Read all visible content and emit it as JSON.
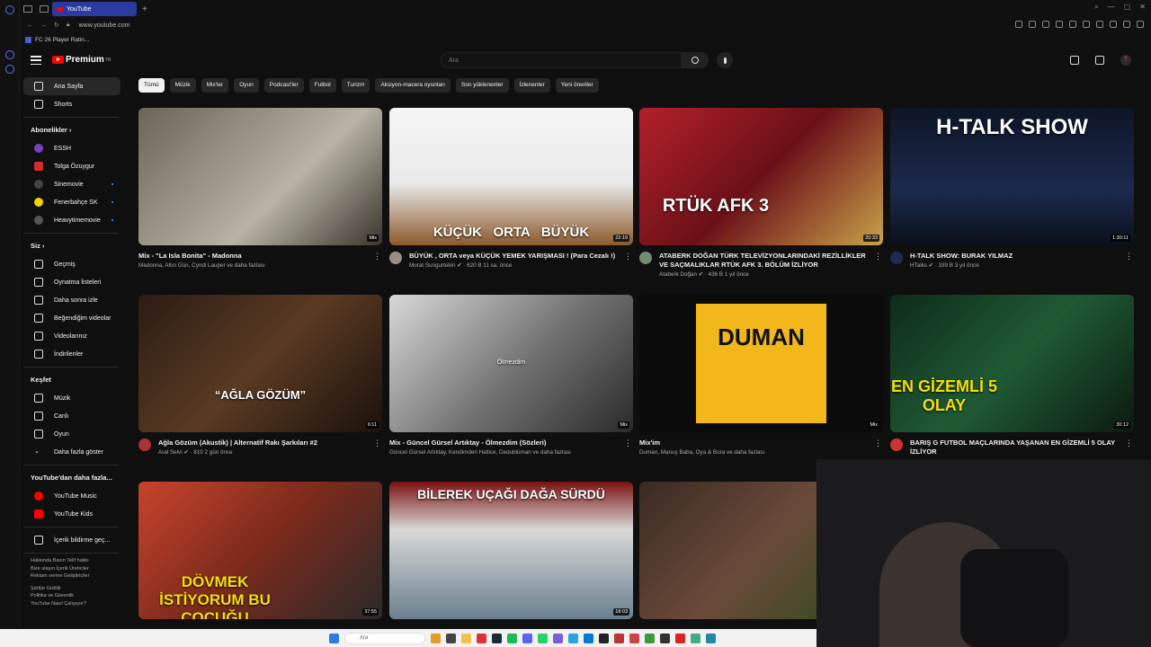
{
  "browser": {
    "tab_title": "YouTube",
    "url": "www.youtube.com",
    "bookmark": "FC 26 Player Ratin..."
  },
  "header": {
    "logo_text": "Premium",
    "logo_sup": "TR",
    "search_placeholder": "Ara",
    "avatar_letter": "T"
  },
  "sidebar": {
    "main": [
      {
        "label": "Ana Sayfa"
      },
      {
        "label": "Shorts"
      }
    ],
    "subs_title": "Abonelikler",
    "subs": [
      {
        "label": "ESSH",
        "color": "#7a3fc4"
      },
      {
        "label": "Tolga Özuygur",
        "color": "#d92b2b"
      },
      {
        "label": "Sinemovie",
        "color": "#444444"
      },
      {
        "label": "Fenerbahçe SK",
        "color": "#f5d000"
      },
      {
        "label": "Heavytimemovie",
        "color": "#555555"
      }
    ],
    "you_title": "Siz",
    "you": [
      {
        "label": "Geçmiş"
      },
      {
        "label": "Oynatma listeleri"
      },
      {
        "label": "Daha sonra izle"
      },
      {
        "label": "Beğendiğim videolar"
      },
      {
        "label": "Videolarınız"
      },
      {
        "label": "İndirilenler"
      }
    ],
    "explore_title": "Keşfet",
    "explore": [
      {
        "label": "Müzik"
      },
      {
        "label": "Canlı"
      },
      {
        "label": "Oyun"
      },
      {
        "label": "Daha fazla göster"
      }
    ],
    "more_title": "YouTube'dan daha fazla...",
    "more": [
      {
        "label": "YouTube Music"
      },
      {
        "label": "YouTube Kids"
      }
    ],
    "report": "İçerik bildirme geç...",
    "footer": [
      "Hakkında  Basın  Telif hakkı",
      "Bize ulaşın  İçerik Üreticiler",
      "Reklam verme  Geliştiriciler",
      "",
      "Şartlar  Gizlilik",
      "Politika ve Güvenlik",
      "YouTube Nasıl Çalışıyor?"
    ]
  },
  "chips": [
    "Tümü",
    "Müzik",
    "Mix'ler",
    "Oyun",
    "Podcast'ler",
    "Futbol",
    "Turizm",
    "Aksiyon-macera oyunları",
    "Son yüklenenler",
    "İzlenenler",
    "Yeni öneriler"
  ],
  "videos": [
    {
      "title": "Mix - \"La Isla Bonita\" - Madonna",
      "channel": "Madonna, Altın Gün, Cyndi Lauper ve daha fazlası",
      "stats": "",
      "duration": "Mix",
      "thumb_text": "",
      "bg": "linear-gradient(135deg,#6b6458,#b8b3a6 60%,#3a342c)",
      "avatar": ""
    },
    {
      "title": "BÜYÜK , ORTA veya KÜÇÜK YEMEK YARIŞMASI ! (Para Cezalı !)",
      "channel": "Murat Sungurtekin",
      "stats": "620 B  11 sa. önce",
      "duration": "22:19",
      "thumb_text": "KÜÇÜK   ORTA   BÜYÜK",
      "bg": "linear-gradient(180deg,#f5f5f5,#e9e9e9 55%,#8b5a2b)",
      "avatar": "#9a8f7e"
    },
    {
      "title": "ATABERK DOĞAN TÜRK TELEVİZYONLARINDAKİ REZİLLİKLER VE SAÇMALIKLAR RTÜK AFK 3. BÖLÜM İZLİYOR",
      "channel": "Ataberk Doğan",
      "stats": "436 B  1 yıl önce",
      "duration": "20:33",
      "thumb_text": "RTÜK AFK 3",
      "bg": "linear-gradient(135deg,#b3202a,#6b1018 50%,#c9a24a)",
      "avatar": "#6f8c74"
    },
    {
      "title": "H-TALK SHOW: BURAK YILMAZ",
      "channel": "HTalks",
      "stats": "339 B  3 yıl önce",
      "duration": "1:30:11",
      "thumb_text": "H-TALK SHOW",
      "bg": "linear-gradient(180deg,#0d1426,#1b2a4d 60%,#0b0f1a)",
      "avatar": "#1f2a52"
    },
    {
      "title": "Ağla Gözüm (Akustik) | Alternatif Rakı Şarkıları #2",
      "channel": "Aral Selvi",
      "stats": "810  2 gün önce",
      "duration": "6:11",
      "thumb_text": "“AĞLA GÖZÜM”",
      "bg": "linear-gradient(135deg,#2b1c14,#5a3a22 50%,#1a110b)",
      "avatar": "#a33"
    },
    {
      "title": "Mix - Güncel Gürsel Artıktay - Ölmezdim (Sözleri)",
      "channel": "Güncel Gürsel Artıktay, Kendimden Hallice, Dedublüman ve daha fazlası",
      "stats": "",
      "duration": "Mix",
      "thumb_text": "Ölmezdim",
      "bg": "linear-gradient(135deg,#d9d9d9,#6f6f6f 55%,#2a2a2a)",
      "avatar": ""
    },
    {
      "title": "Mix'im",
      "channel": "Duman, Manuş Baba, Oya & Bora ve daha fazlası",
      "stats": "",
      "duration": "Mix",
      "thumb_text": "DUMAN",
      "bg": "#0b0b0b",
      "avatar": ""
    },
    {
      "title": "BARIŞ G FUTBOL MAÇLARINDA YAŞANAN EN GİZEMLİ 5 OLAY İZLİYOR",
      "channel": "",
      "stats": "",
      "duration": "30:12",
      "thumb_text": "EN GİZEMLİ 5 OLAY",
      "bg": "linear-gradient(135deg,#0f2b1a,#1f5a34 50%,#0b1a10)",
      "avatar": "#c33"
    },
    {
      "title": "",
      "channel": "",
      "stats": "",
      "duration": "37:55",
      "thumb_text": "DÖVMEK İSTİYORUM BU ÇOCUĞU",
      "bg": "linear-gradient(135deg,#c8432b,#7a2a1c 50%,#2a2a2a)",
      "avatar": ""
    },
    {
      "title": "",
      "channel": "",
      "stats": "",
      "duration": "18:03",
      "thumb_text": "BİLEREK UÇAĞI DAĞA SÜRDÜ",
      "bg": "linear-gradient(180deg,#7a1010,#d9d9d9 35%,#6b7f8f)",
      "avatar": ""
    },
    {
      "title": "",
      "channel": "",
      "stats": "",
      "duration": "",
      "thumb_text": "",
      "bg": "linear-gradient(135deg,#3a2a22,#6b4a3a 50%,#2a4a1a)",
      "avatar": ""
    }
  ],
  "taskbar": {
    "search": "Ara"
  }
}
